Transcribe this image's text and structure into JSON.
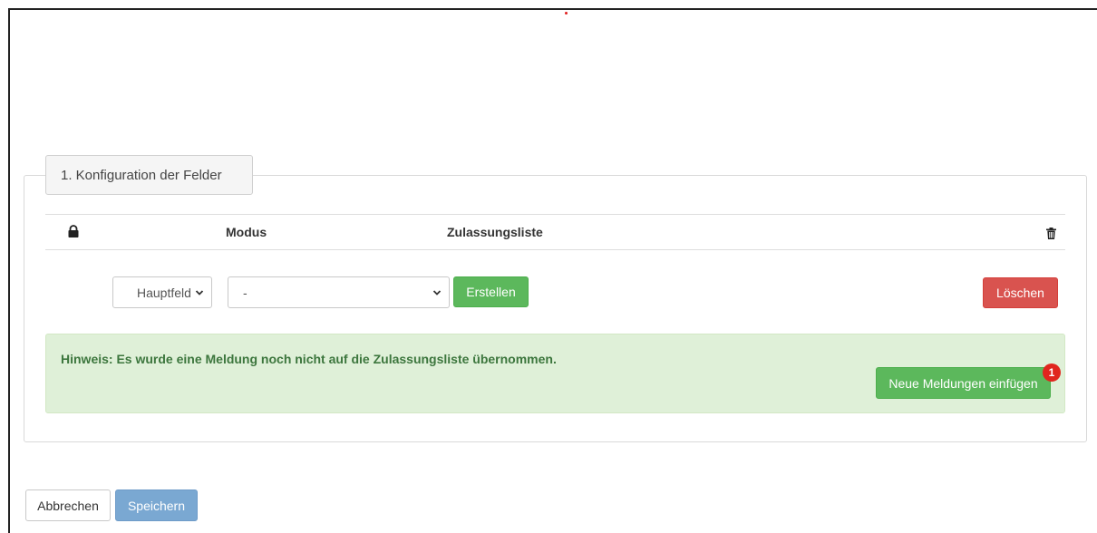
{
  "fieldset": {
    "legend": "1. Konfiguration der Felder"
  },
  "table": {
    "headers": {
      "modus": "Modus",
      "zulassungsliste": "Zulassungsliste"
    }
  },
  "row": {
    "field_select_value": "Hauptfeld",
    "list_select_value": "-",
    "create_label": "Erstellen",
    "delete_label": "Löschen"
  },
  "alert": {
    "text": "Hinweis: Es wurde eine Meldung noch nicht auf die Zulassungsliste übernommen.",
    "button_label": "Neue Meldungen einfügen",
    "badge_count": "1"
  },
  "footer": {
    "cancel_label": "Abbrechen",
    "save_label": "Speichern"
  },
  "icons": {
    "header_left": "lock-icon",
    "header_right": "trash-icon"
  },
  "colors": {
    "success": "#5cb85c",
    "danger": "#d9534f",
    "primary_disabled": "#7aa8d2",
    "alert_bg": "#dff0d8",
    "alert_text": "#3c763d",
    "badge": "#e0261e"
  }
}
